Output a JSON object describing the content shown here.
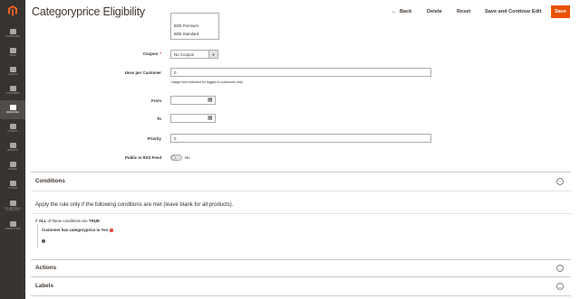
{
  "header": {
    "title": "Categoryprice Eligibility",
    "back_label": "Back",
    "delete_label": "Delete",
    "reset_label": "Reset",
    "save_continue_label": "Save and Continue Edit",
    "save_label": "Save",
    "save_color": "#eb5202"
  },
  "sidebar": {
    "items": [
      {
        "label": "Dashboard",
        "icon": "dashboard-icon"
      },
      {
        "label": "Sales",
        "icon": "dollar-icon"
      },
      {
        "label": "Catalog",
        "icon": "catalog-icon"
      },
      {
        "label": "Customers",
        "icon": "customers-icon"
      },
      {
        "label": "Marketing",
        "icon": "megaphone-icon",
        "active": true
      },
      {
        "label": "Content",
        "icon": "content-icon"
      },
      {
        "label": "Reports",
        "icon": "reports-icon"
      },
      {
        "label": "Stores",
        "icon": "stores-icon"
      },
      {
        "label": "System",
        "icon": "gear-icon"
      },
      {
        "label": "Find Partners & Extensions",
        "icon": "partners-icon"
      },
      {
        "label": "Pricesystem",
        "icon": "pricesystem-icon"
      }
    ]
  },
  "form": {
    "customer_groups_options": [
      "B2B Premium",
      "B2B Standard"
    ],
    "coupon_label": "Coupon",
    "coupon_value": "No Coupon",
    "uses_per_customer_label": "Uses per Customer",
    "uses_per_customer_value": "0",
    "uses_per_customer_note": "Usage limit enforced for logged in customers only.",
    "from_label": "From",
    "from_value": "",
    "to_label": "To",
    "to_value": "",
    "priority_label": "Priority",
    "priority_value": "0",
    "rss_label": "Public In RSS Feed",
    "rss_value": "No"
  },
  "sections": {
    "conditions_title": "Conditions",
    "conditions_desc": "Apply the rule only if the following conditions are met (leave blank for all products).",
    "rule_if": "If",
    "rule_all": "ALL",
    "rule_mid": "of these conditions are",
    "rule_true": "TRUE",
    "rule_colon": ":",
    "condition_text": "Customer has categoryprice",
    "condition_is": "is",
    "condition_value": "Yes",
    "actions_title": "Actions",
    "labels_title": "Labels"
  }
}
